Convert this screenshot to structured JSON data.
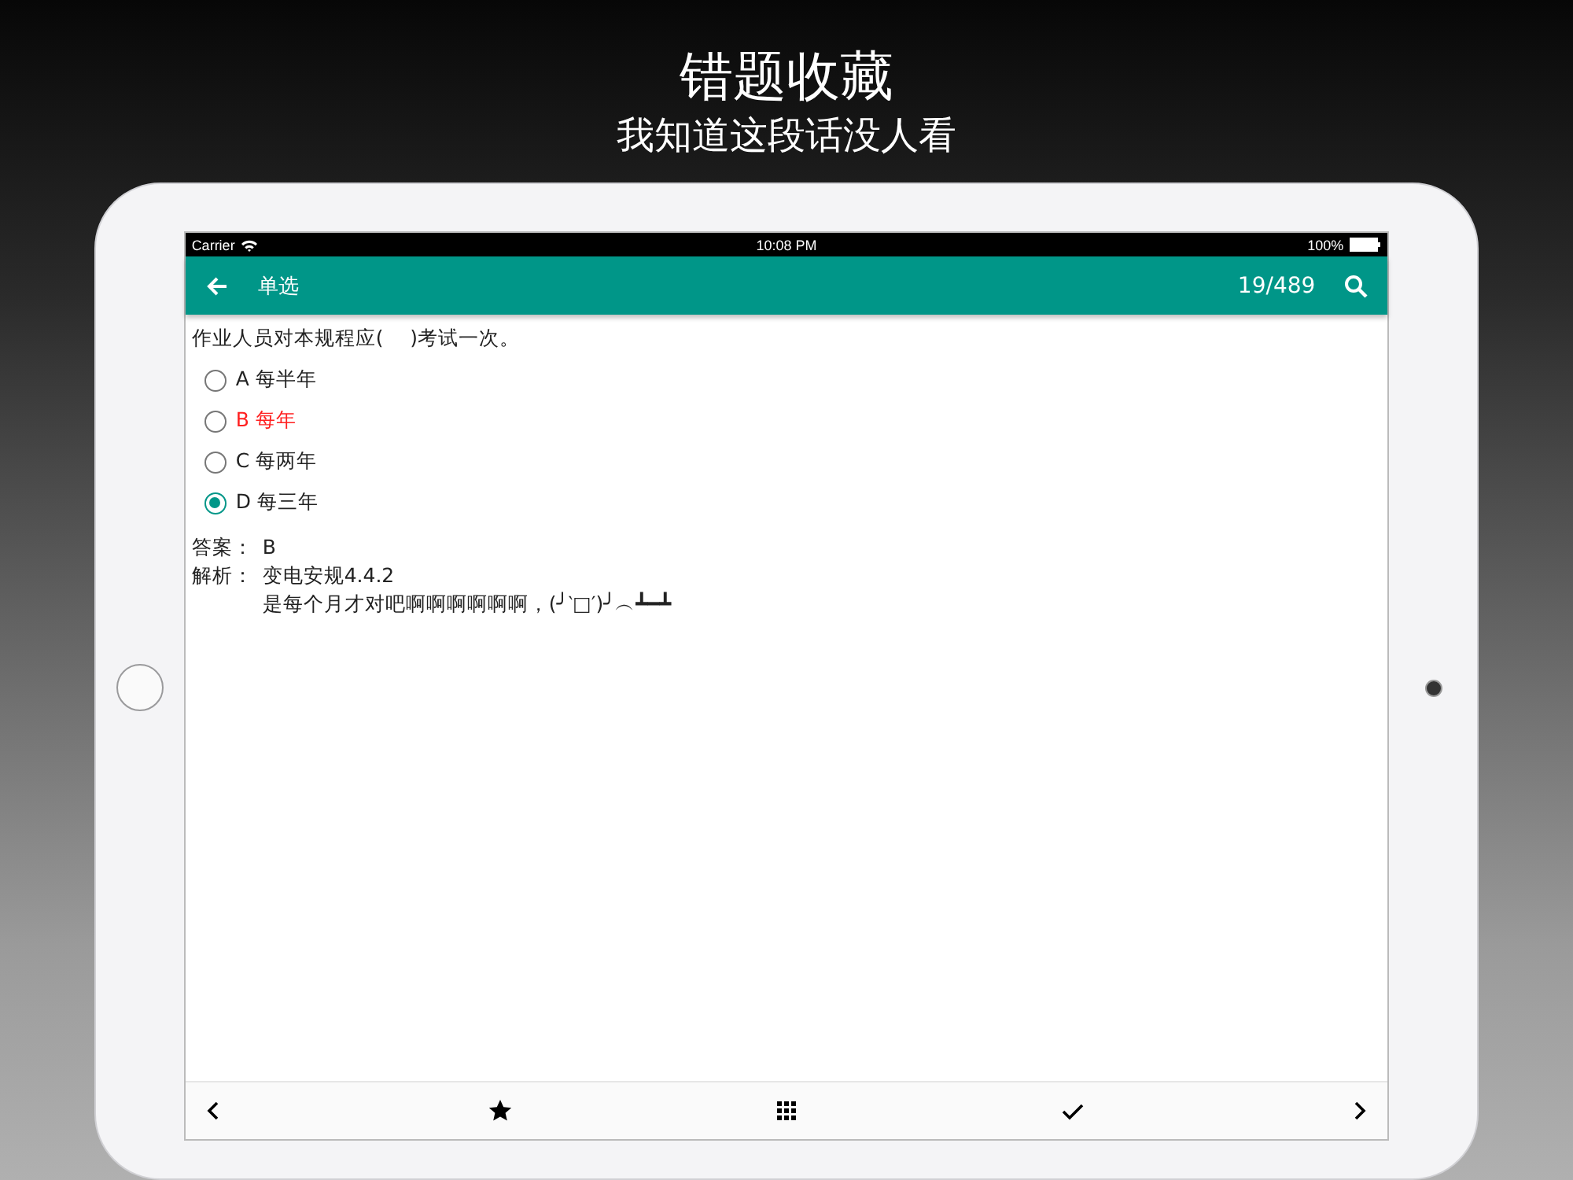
{
  "headline": {
    "title": "错题收藏",
    "subtitle": "我知道这段话没人看"
  },
  "status_bar": {
    "carrier": "Carrier",
    "time": "10:08 PM",
    "battery": "100%"
  },
  "app_bar": {
    "title": "单选",
    "counter": "19/489"
  },
  "question": {
    "text": "作业人员对本规程应(　 )考试一次。",
    "options": [
      {
        "label": "A 每半年",
        "selected": false,
        "correct": false
      },
      {
        "label": "B 每年",
        "selected": false,
        "correct": true
      },
      {
        "label": "C 每两年",
        "selected": false,
        "correct": false
      },
      {
        "label": "D 每三年",
        "selected": true,
        "correct": false
      }
    ],
    "answer_label": "答案：",
    "answer": "B",
    "analysis_label": "解析：",
    "analysis": [
      "变电安规4.4.2",
      "是每个月才对吧啊啊啊啊啊啊，(╯‵□′)╯︵┻━┻"
    ]
  },
  "toolbar": [
    {
      "kind": "prev"
    },
    {
      "kind": "star"
    },
    {
      "kind": "grid"
    },
    {
      "kind": "check"
    },
    {
      "kind": "next"
    }
  ]
}
